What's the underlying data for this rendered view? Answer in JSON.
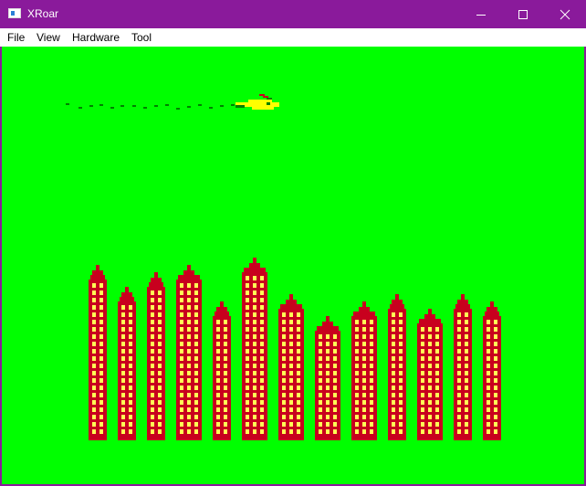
{
  "window": {
    "title": "XRoar",
    "minimize_label": "Minimize",
    "maximize_label": "Maximize",
    "close_label": "Close"
  },
  "menu": {
    "items": [
      "File",
      "View",
      "Hardware",
      "Tool"
    ]
  },
  "game": {
    "background_color": "#00ff00",
    "building_color": "#c8001e",
    "window_color": "#ffff55",
    "plane_color": "#ffff00",
    "buildings": [
      {
        "id": 1,
        "rows": 21,
        "window_columns": 2
      },
      {
        "id": 2,
        "rows": 18,
        "window_columns": 2
      },
      {
        "id": 3,
        "rows": 20,
        "window_columns": 2
      },
      {
        "id": 4,
        "rows": 21,
        "window_columns": 3
      },
      {
        "id": 5,
        "rows": 16,
        "window_columns": 2
      },
      {
        "id": 6,
        "rows": 22,
        "window_columns": 3
      },
      {
        "id": 7,
        "rows": 17,
        "window_columns": 3
      },
      {
        "id": 8,
        "rows": 14,
        "window_columns": 3
      },
      {
        "id": 9,
        "rows": 16,
        "window_columns": 3
      },
      {
        "id": 10,
        "rows": 17,
        "window_columns": 2
      },
      {
        "id": 11,
        "rows": 15,
        "window_columns": 3
      },
      {
        "id": 12,
        "rows": 17,
        "window_columns": 2
      },
      {
        "id": 13,
        "rows": 16,
        "window_columns": 2
      }
    ]
  }
}
